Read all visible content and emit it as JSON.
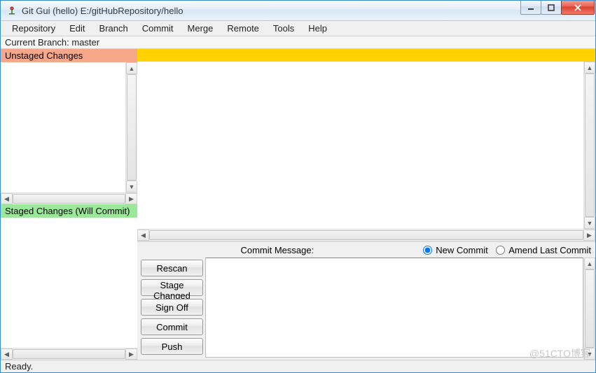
{
  "window": {
    "title": "Git Gui (hello) E:/gitHubRepository/hello"
  },
  "menu": {
    "items": [
      "Repository",
      "Edit",
      "Branch",
      "Commit",
      "Merge",
      "Remote",
      "Tools",
      "Help"
    ]
  },
  "branch_line": "Current Branch: master",
  "panes": {
    "unstaged_header": "Unstaged Changes",
    "staged_header": "Staged Changes (Will Commit)"
  },
  "commit": {
    "message_label": "Commit Message:",
    "new_commit": "New Commit",
    "amend": "Amend Last Commit",
    "selected_mode": "new",
    "message_value": "",
    "buttons": {
      "rescan": "Rescan",
      "stage_changed": "Stage Changed",
      "sign_off": "Sign Off",
      "commit": "Commit",
      "push": "Push"
    }
  },
  "status": "Ready.",
  "watermark": "@51CTO博客"
}
